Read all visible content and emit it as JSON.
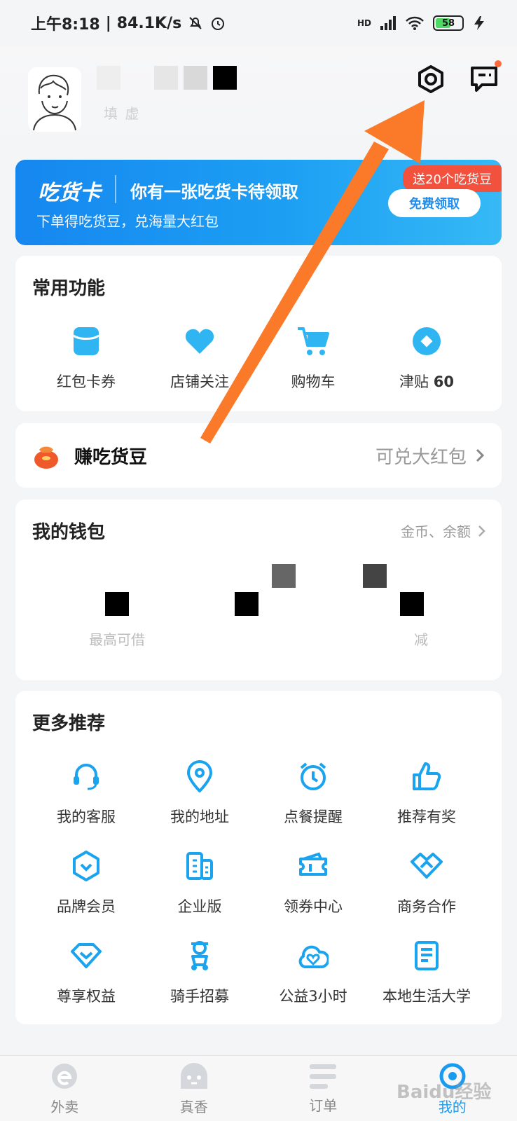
{
  "status_bar": {
    "time": "上午8:18",
    "speed": "84.1K/s",
    "network": "HD",
    "battery": "58",
    "battery_level": 0.58
  },
  "profile": {
    "subtitle_visible": "填      虚"
  },
  "banner": {
    "brand": "吃货卡",
    "title": "你有一张吃货卡待领取",
    "subtitle": "下单得吃货豆，兑海量大红包",
    "badge": "送20个吃货豆",
    "cta": "免费领取"
  },
  "common": {
    "title": "常用功能",
    "items": [
      {
        "label": "红包卡券",
        "icon": "coupon-icon"
      },
      {
        "label": "店铺关注",
        "icon": "heart-icon"
      },
      {
        "label": "购物车",
        "icon": "cart-icon"
      },
      {
        "label": "津贴",
        "value": "60",
        "icon": "allowance-icon"
      }
    ]
  },
  "beans": {
    "title": "赚吃货豆",
    "right": "可兑大红包"
  },
  "wallet": {
    "title": "我的钱包",
    "link": "金币、余额",
    "cols": [
      {
        "foot": "最高可借"
      },
      {
        "foot": ""
      },
      {
        "foot": "减"
      }
    ]
  },
  "more": {
    "title": "更多推荐",
    "items": [
      {
        "label": "我的客服",
        "icon": "headset-icon"
      },
      {
        "label": "我的地址",
        "icon": "location-icon"
      },
      {
        "label": "点餐提醒",
        "icon": "alarm-icon"
      },
      {
        "label": "推荐有奖",
        "icon": "thumbs-up-icon"
      },
      {
        "label": "品牌会员",
        "icon": "shield-icon"
      },
      {
        "label": "企业版",
        "icon": "building-icon"
      },
      {
        "label": "领券中心",
        "icon": "ticket-icon"
      },
      {
        "label": "商务合作",
        "icon": "handshake-icon"
      },
      {
        "label": "尊享权益",
        "icon": "diamond-icon"
      },
      {
        "label": "骑手招募",
        "icon": "rider-icon"
      },
      {
        "label": "公益3小时",
        "icon": "cloud-heart-icon"
      },
      {
        "label": "本地生活大学",
        "icon": "book-icon"
      }
    ]
  },
  "tabs": [
    {
      "label": "外卖",
      "icon": "eleme-icon"
    },
    {
      "label": "真香",
      "icon": "ghost-icon"
    },
    {
      "label": "订单",
      "icon": "list-icon"
    },
    {
      "label": "我的",
      "icon": "me-icon"
    }
  ],
  "watermark": "Baidu经验",
  "colors": {
    "accent": "#1a9bf2",
    "banner_start": "#1687f0",
    "banner_end": "#36b9f5",
    "badge": "#f2513d",
    "annotation_arrow": "#fb7a2a"
  }
}
